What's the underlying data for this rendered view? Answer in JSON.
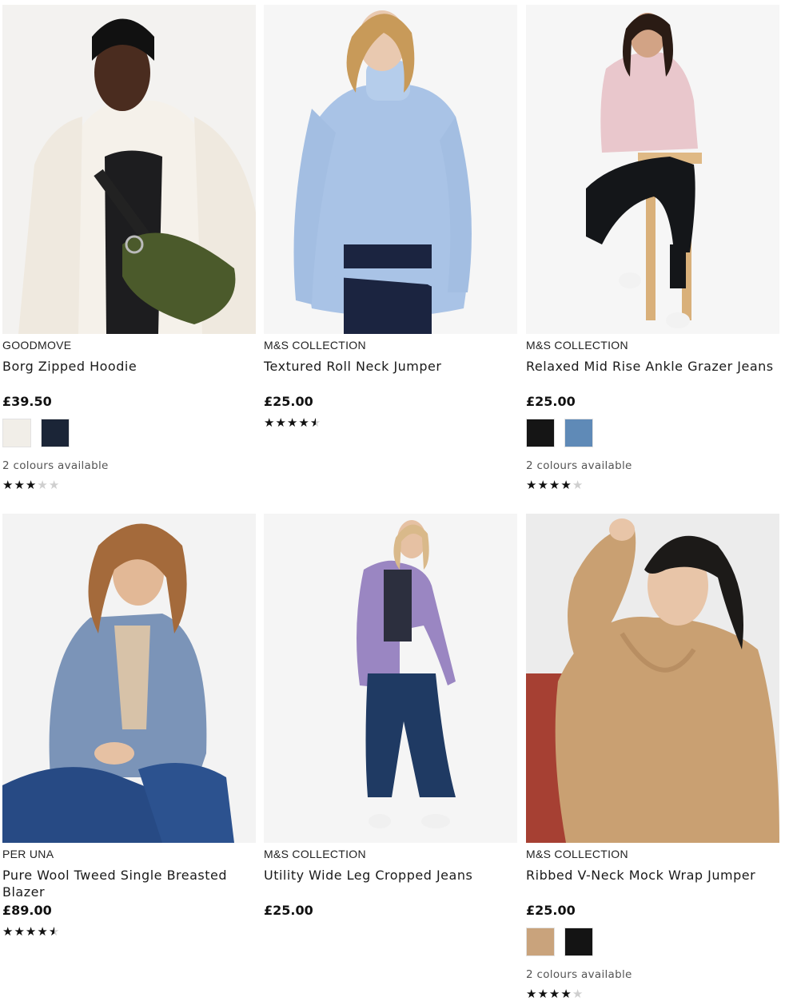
{
  "products": [
    {
      "brand": "GOODMOVE",
      "name": "Borg Zipped Hoodie",
      "price": "£39.50",
      "swatches": [
        "#f1eee8",
        "#1b2537"
      ],
      "colours_text": "2 colours available",
      "rating": 3
    },
    {
      "brand": "M&S COLLECTION",
      "name": "Textured Roll Neck Jumper",
      "price": "£25.00",
      "swatches": [],
      "colours_text": "",
      "rating": 4.5
    },
    {
      "brand": "M&S COLLECTION",
      "name": "Relaxed Mid Rise Ankle Grazer Jeans",
      "price": "£25.00",
      "swatches": [
        "#151515",
        "#5f8ab7"
      ],
      "colours_text": "2 colours available",
      "rating": 4
    },
    {
      "brand": "PER UNA",
      "name": "Pure Wool Tweed Single Breasted Blazer",
      "price": "£89.00",
      "swatches": [],
      "colours_text": "",
      "rating": 4.5
    },
    {
      "brand": "M&S COLLECTION",
      "name": "Utility Wide Leg Cropped Jeans",
      "price": "£25.00",
      "swatches": [],
      "colours_text": "",
      "rating": 0
    },
    {
      "brand": "M&S COLLECTION",
      "name": "Ribbed V-Neck Mock Wrap Jumper",
      "price": "£25.00",
      "swatches": [
        "#c9a37c",
        "#141414"
      ],
      "colours_text": "2 colours available",
      "rating": 4
    }
  ],
  "colors": {
    "star_on": "#111111",
    "star_off": "#cfcfcf",
    "text_secondary": "#555555"
  }
}
